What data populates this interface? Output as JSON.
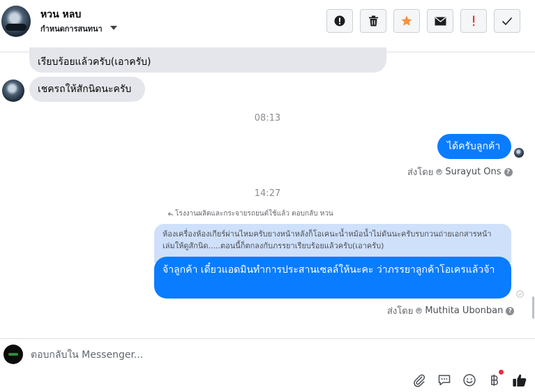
{
  "header": {
    "contact_name": "หวน หลบ",
    "manage_label": "กำหนดการสนทนา"
  },
  "toolbar": {
    "buttons": [
      {
        "icon": "info-icon"
      },
      {
        "icon": "trash-icon"
      },
      {
        "icon": "star-icon",
        "color": "#f7923b"
      },
      {
        "icon": "envelope-icon"
      },
      {
        "icon": "exclamation-icon",
        "color": "#e4383a"
      },
      {
        "icon": "checkmark-icon"
      }
    ]
  },
  "messages": {
    "incoming_1": "เรียบร้อยแล้วครับ(เอาครับ)",
    "incoming_2": "เชครถให้สักนิดนะครับ",
    "time_1": "08:13",
    "outgoing_1": "ได้ครับลูกค้า",
    "sent_by_label": "ส่งโดย",
    "sender_1": "Surayut Ons",
    "time_2": "14:27",
    "reply_context": "โรงงานผลิตและกระจายรถยนต์ใช้แล้ว ตอบกลับ หวน",
    "quoted_text": "ห้องเครื่องห้องเกียร์ผ่านไหมครับยางหน้าหลังก็โอเคนะน้ำหม้อน้ำไม่ดันนะครับรบกวนถ่ายเอกสารหน้าเล่มให้ดูสักนิด.....ตอนนี้ก็ตกลงกับภรรยาเรียบร้อยแล้วครับ(เอาครับ)",
    "outgoing_2": "จ้าลูกค้า เดี๋ยวแอดมินทำการประสานเซลล์ให้นะคะ ว่าภรรยาลูกค้าโอเครแล้วจ้า",
    "sender_2": "Muthita Ubonban"
  },
  "composer": {
    "placeholder": "ตอบกลับใน Messenger...",
    "tools": [
      "paperclip-icon",
      "chat-bubble-icon",
      "emoji-icon",
      "baht-icon",
      "thumbs-up-icon"
    ],
    "badge_color": "#f02849"
  },
  "colors": {
    "accent": "#0a7cff",
    "quoted_bg": "#cfe0fb",
    "incoming_bg": "#e4e6eb"
  }
}
